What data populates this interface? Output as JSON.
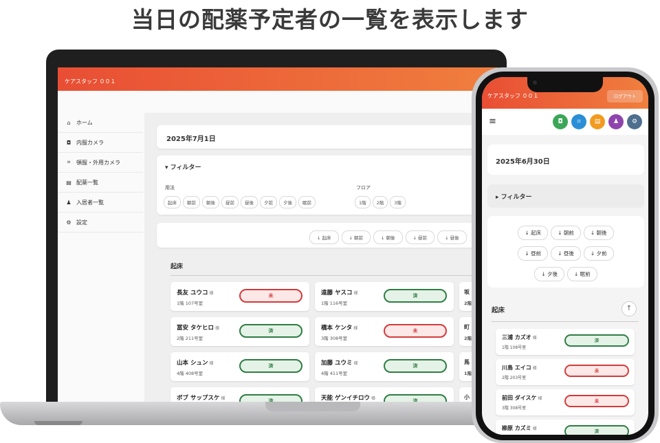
{
  "headline": "当日の配薬予定者の一覧を表示します",
  "laptop": {
    "app_title": "ケアスタッフ ００１",
    "nav": [
      {
        "icon": "home-icon",
        "glyph": "⌂",
        "label": "ホーム"
      },
      {
        "icon": "camera-icon",
        "glyph": "◘",
        "label": "内服カメラ"
      },
      {
        "icon": "scan-icon",
        "glyph": "⌗",
        "label": "頓服・外用カメラ"
      },
      {
        "icon": "list-icon",
        "glyph": "▤",
        "label": "配薬一覧"
      },
      {
        "icon": "people-icon",
        "glyph": "♟",
        "label": "入居者一覧"
      },
      {
        "icon": "gear-icon",
        "glyph": "⚙",
        "label": "設定"
      }
    ],
    "date": "2025年7月1日",
    "filter_title": "▾ フィルター",
    "usage_label": "用法",
    "usage_chips": [
      "起床",
      "朝前",
      "朝後",
      "昼前",
      "昼後",
      "夕前",
      "夕後",
      "眠前"
    ],
    "floor_label": "フロア",
    "floor_chips": [
      "1階",
      "2階",
      "3階"
    ],
    "sort_chips": [
      "↓ 起床",
      "↓ 朝前",
      "↓ 朝後",
      "↓ 昼前",
      "↓ 昼後"
    ],
    "section_title": "起床",
    "patients": [
      {
        "name": "長友 ユウコ",
        "room": "1階 107号室",
        "status": "未"
      },
      {
        "name": "遠藤 ヤスコ",
        "room": "1階 116号室",
        "status": "済"
      },
      {
        "name": "冨安 タケヒロ",
        "room": "2階 211号室",
        "status": "済"
      },
      {
        "name": "橋本 ケンタ",
        "room": "3階 308号室",
        "status": "未"
      },
      {
        "name": "山本 シュン",
        "room": "4階 408号室",
        "status": "済"
      },
      {
        "name": "加藤 ユウミ",
        "room": "4階 411号室",
        "status": "済"
      },
      {
        "name": "ボブ サップスケ",
        "room": "2階 206号室",
        "status": "済"
      },
      {
        "name": "天能 ゲンイチロウ",
        "room": "3階 305号室",
        "status": "済"
      }
    ],
    "peek_col": [
      "坂",
      "町",
      "馬",
      "小"
    ],
    "peek_room": [
      "2階",
      "2階",
      "1階",
      "3階"
    ],
    "honorific": "様"
  },
  "phone": {
    "app_title": "ケアスタッフ ００１",
    "logout_label": "ログアウト",
    "menu_glyph": "≡",
    "toolbar_icons": [
      {
        "name": "camera-icon",
        "glyph": "◘",
        "color": "#3aa757"
      },
      {
        "name": "scan-icon",
        "glyph": "⌗",
        "color": "#2b8fd6"
      },
      {
        "name": "list-icon",
        "glyph": "▤",
        "color": "#f29b1f"
      },
      {
        "name": "people-icon",
        "glyph": "♟",
        "color": "#8e44ad"
      },
      {
        "name": "gear-icon",
        "glyph": "⚙",
        "color": "#4f6f8f"
      }
    ],
    "date": "2025年6月30日",
    "filter_title": "▸ フィルター",
    "sort_rows": [
      [
        "↓ 起床",
        "↓ 朝前",
        "↓ 朝後"
      ],
      [
        "↓ 昼前",
        "↓ 昼後",
        "↓ 夕前"
      ],
      [
        "↓ 夕後",
        "↓ 眠前"
      ]
    ],
    "section_title": "起床",
    "up_glyph": "↑",
    "patients": [
      {
        "name": "三浦 カズオ",
        "room": "1階 108号室",
        "status": "済"
      },
      {
        "name": "川島 エイコ",
        "room": "2階 203号室",
        "status": "未"
      },
      {
        "name": "前田 ダイスケ",
        "room": "3階 308号室",
        "status": "未"
      },
      {
        "name": "柳原 カズミ",
        "room": "",
        "status": "済"
      }
    ],
    "honorific": "様"
  },
  "colors": {
    "appbar_start": "#e84e34",
    "appbar_end": "#f07f3e",
    "done": "#2e7d43",
    "not_done": "#d43a3a"
  }
}
